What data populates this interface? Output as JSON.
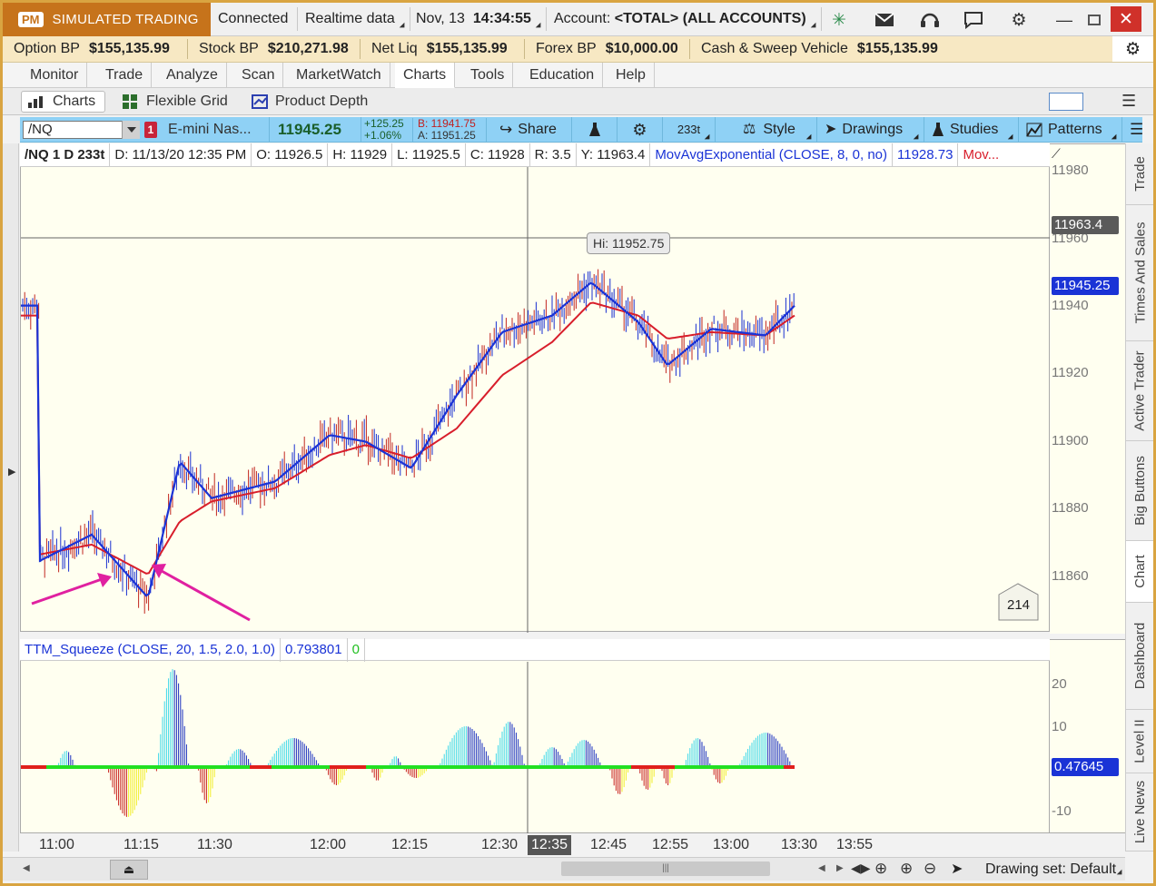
{
  "titlebar": {
    "badge": "PM",
    "mode": "SIMULATED TRADING",
    "connection": "Connected",
    "data_feed": "Realtime data",
    "date": "Nov, 13",
    "time": "14:34:55",
    "account_label": "Account:",
    "account_value": "<TOTAL> (ALL ACCOUNTS)"
  },
  "balances": [
    {
      "label": "Option BP",
      "value": "$155,135.99"
    },
    {
      "label": "Stock BP",
      "value": "$210,271.98"
    },
    {
      "label": "Net Liq",
      "value": "$155,135.99"
    },
    {
      "label": "Forex BP",
      "value": "$10,000.00"
    },
    {
      "label": "Cash & Sweep Vehicle",
      "value": "$155,135.99"
    }
  ],
  "nav_tabs": [
    "Monitor",
    "Trade",
    "Analyze",
    "Scan",
    "MarketWatch",
    "Charts",
    "Tools",
    "Education",
    "Help"
  ],
  "nav_active": "Charts",
  "sub_tabs": [
    "Charts",
    "Flexible Grid",
    "Product Depth"
  ],
  "toolbar": {
    "symbol": "/NQ",
    "link_number": "1",
    "description": "E-mini Nas...",
    "last_price": "11945.25",
    "change": "+125.25",
    "change_pct": "+1.06%",
    "bid": "B: 11941.75",
    "ask": "A: 11951.25",
    "share": "Share",
    "aggregation": "233t",
    "style": "Style",
    "drawings": "Drawings",
    "studies": "Studies",
    "patterns": "Patterns"
  },
  "info_bar": {
    "symbol_period": "/NQ 1 D 233t",
    "date": "D: 11/13/20 12:35 PM",
    "open": "O: 11926.5",
    "high": "H: 11929",
    "low": "L: 11925.5",
    "close": "C: 11928",
    "range": "R: 3.5",
    "y": "Y: 11963.4",
    "study": "MovAvgExponential (CLOSE, 8, 0, no)",
    "study_value": "11928.73",
    "study2": "Mov..."
  },
  "hi_label": "Hi: 11952.75",
  "bar_count": "214",
  "price_axis": {
    "ticks": [
      "11980",
      "11960",
      "11940",
      "11920",
      "11900",
      "11880",
      "11860"
    ],
    "crosshair_value": "11963.4",
    "last_value": "11945.25"
  },
  "ttm_bar": {
    "study": "TTM_Squeeze (CLOSE, 20, 1.5, 2.0, 1.0)",
    "value": "0.793801",
    "signal": "0"
  },
  "lower_axis": {
    "ticks": [
      "20",
      "10",
      "-10"
    ],
    "last_value": "0.47645"
  },
  "time_axis": {
    "ticks": [
      "11:00",
      "11:15",
      "11:30",
      "12:00",
      "12:15",
      "12:30",
      "12:45",
      "12:55",
      "13:00",
      "13:30",
      "13:55"
    ],
    "cursor": "12:35"
  },
  "right_tabs": [
    "Trade",
    "Times And Sales",
    "Active Trader",
    "Big Buttons",
    "Chart",
    "Dashboard",
    "Level II",
    "Live News"
  ],
  "right_active": "Chart",
  "drawing_set": "Drawing set: Default",
  "colors": {
    "accent": "#c6731b",
    "toolbar": "#8fd1f5",
    "ema_fast": "#1a33d6",
    "ema_slow": "#d81e2b",
    "up_bar": "#1a2fd0",
    "down_bar": "#c2261f",
    "arrow": "#e020a0",
    "squeeze_on": "#e0201c",
    "squeeze_off": "#22e022"
  },
  "chart_data": {
    "type": "line",
    "title": "/NQ 1 D 233t",
    "xlabel": "",
    "ylabel": "",
    "x": [
      "11:00",
      "11:08",
      "11:15",
      "11:22",
      "11:30",
      "11:45",
      "12:00",
      "12:10",
      "12:15",
      "12:25",
      "12:30",
      "12:38",
      "12:45",
      "12:52",
      "12:55",
      "13:00",
      "13:15",
      "13:30"
    ],
    "ylim": [
      11845,
      11985
    ],
    "series": [
      {
        "name": "MovAvgExponential",
        "values": [
          11866,
          11874,
          11855,
          11896,
          11885,
          11890,
          11904,
          11902,
          11894,
          11916,
          11935,
          11940,
          11950,
          11938,
          11925,
          11936,
          11934,
          11943
        ]
      },
      {
        "name": "Mov...",
        "values": [
          11868,
          11871,
          11862,
          11878,
          11884,
          11888,
          11898,
          11901,
          11897,
          11906,
          11922,
          11932,
          11944,
          11940,
          11933,
          11935,
          11934,
          11940
        ]
      }
    ]
  }
}
